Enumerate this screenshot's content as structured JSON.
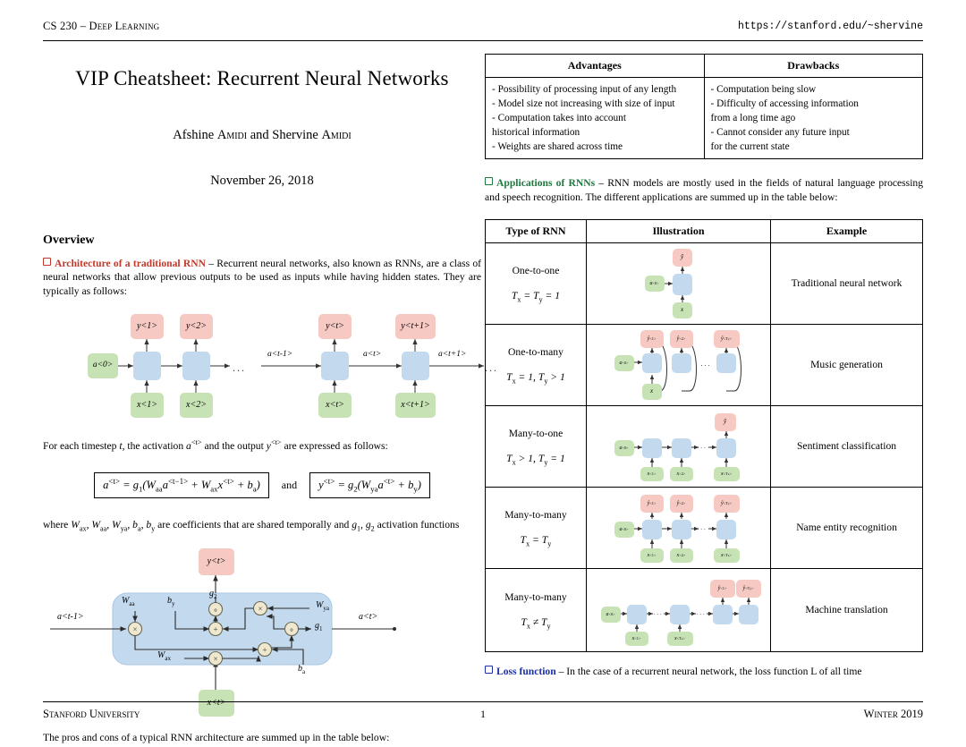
{
  "header": {
    "course": "CS 230 – Deep Learning",
    "url": "https://stanford.edu/~shervine"
  },
  "footer": {
    "left": "Stanford University",
    "page": "1",
    "right": "Winter 2019"
  },
  "title": "VIP Cheatsheet: Recurrent Neural Networks",
  "authors": "Afshine Amidi and Shervine Amidi",
  "date": "November 26, 2018",
  "overview": {
    "heading": "Overview",
    "arch_tag": "Architecture of a traditional RNN",
    "arch_text": "– Recurrent neural networks, also known as RNNs, are a class of neural networks that allow previous outputs to be used as inputs while having hidden states. They are typically as follows:",
    "timestep_text_a": "For each timestep",
    "timestep_text_b": ", the activation",
    "timestep_text_c": "and the output",
    "timestep_text_d": "are expressed as follows:",
    "eq_activation": "a<t> = g₁(W_aa a<t−1> + W_ax x<t> + b_a)",
    "eq_and": "and",
    "eq_output": "y<t> = g₂(W_ya a<t> + b_y)",
    "where_text": "where W_ax, W_aa, W_ya, b_a, b_y are coefficients that are shared temporally and g₁, g₂ activation functions",
    "pros_cons_caption": "The pros and cons of a typical RNN architecture are summed up in the table below:"
  },
  "unrolled_diagram": {
    "a0": "a<0>",
    "steps": [
      {
        "y": "y<1>",
        "x": "x<1>"
      },
      {
        "y": "y<2>",
        "x": "x<2>"
      },
      {
        "y": "y<t>",
        "x": "x<t>"
      },
      {
        "y": "y<t+1>",
        "x": "x<t+1>"
      }
    ],
    "edge_labels": [
      "a<t-1>",
      "a<t>",
      "a<t+1>"
    ],
    "ellipsis": "..."
  },
  "cell_diagram": {
    "input_left": "a<t-1>",
    "output_right": "a<t>",
    "output_top": "y<t>",
    "input_bottom": "x<t>",
    "weights": [
      "W_aa",
      "W_ax",
      "W_ya"
    ],
    "biases": [
      "b_y",
      "b_a"
    ],
    "activations": [
      "g_1",
      "g_2"
    ],
    "ops": [
      "×",
      "+",
      "∘"
    ]
  },
  "proscons": {
    "headers": [
      "Advantages",
      "Drawbacks"
    ],
    "advantages": [
      "- Possibility of processing input of any length",
      "- Model size not increasing with size of input",
      "- Computation takes into account",
      "historical information",
      "- Weights are shared across time"
    ],
    "drawbacks": [
      "- Computation being slow",
      "- Difficulty of accessing information",
      "from a long time ago",
      "- Cannot consider any future input",
      "for the current state"
    ]
  },
  "applications": {
    "tag": "Applications of RNNs",
    "text": "– RNN models are mostly used in the fields of natural language processing and speech recognition. The different applications are summed up in the table below:",
    "headers": [
      "Type of RNN",
      "Illustration",
      "Example"
    ],
    "rows": [
      {
        "type": "One-to-one",
        "dims": "Tx = Ty = 1",
        "example": "Traditional neural network"
      },
      {
        "type": "One-to-many",
        "dims": "Tx = 1, Ty > 1",
        "example": "Music generation"
      },
      {
        "type": "Many-to-one",
        "dims": "Tx > 1, Ty = 1",
        "example": "Sentiment classification"
      },
      {
        "type": "Many-to-many",
        "dims": "Tx = Ty",
        "example": "Name entity recognition"
      },
      {
        "type": "Many-to-many",
        "dims": "Tx ≠ Ty",
        "example": "Machine translation"
      }
    ]
  },
  "loss": {
    "tag": "Loss function",
    "text": "– In the case of a recurrent neural network, the loss function L of all time"
  },
  "colors": {
    "output_node": "#f6c9c3",
    "hidden_node": "#c3d9ee",
    "input_node": "#c7e3b6",
    "op_node": "#efe8cf",
    "tag_red": "#c0392b",
    "tag_green": "#1f7a3f",
    "tag_blue": "#1b30a8"
  }
}
